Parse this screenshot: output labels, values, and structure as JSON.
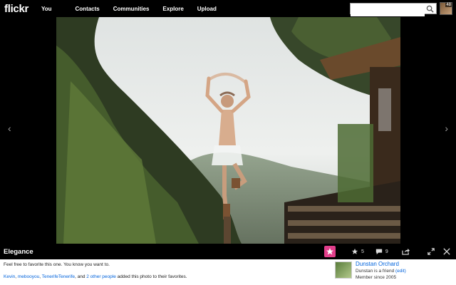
{
  "header": {
    "logo": "flickr",
    "nav": [
      "You",
      "Contacts",
      "Communities",
      "Explore",
      "Upload"
    ],
    "search_placeholder": "",
    "buddy_count": "48"
  },
  "photo": {
    "title": "Elegance",
    "prev_glyph": "‹",
    "next_glyph": "›"
  },
  "actions": {
    "favorites_count": "5",
    "comments_count": "9"
  },
  "info": {
    "description": "Feel free to favorite this one. You know you want to.",
    "favs": {
      "user1": "Kevin",
      "user2": "mebooyou",
      "user3": "TenerifeTenerife",
      "and": ", and ",
      "others": "2 other people",
      "suffix": " added this photo to their favorites."
    },
    "owner": {
      "name": "Dunstan Orchard",
      "friend_text": "Dunstan is a friend ",
      "edit": "(edit)",
      "since": "Member since 2005"
    }
  },
  "colors": {
    "link": "#0063dc",
    "background": "#000000"
  }
}
